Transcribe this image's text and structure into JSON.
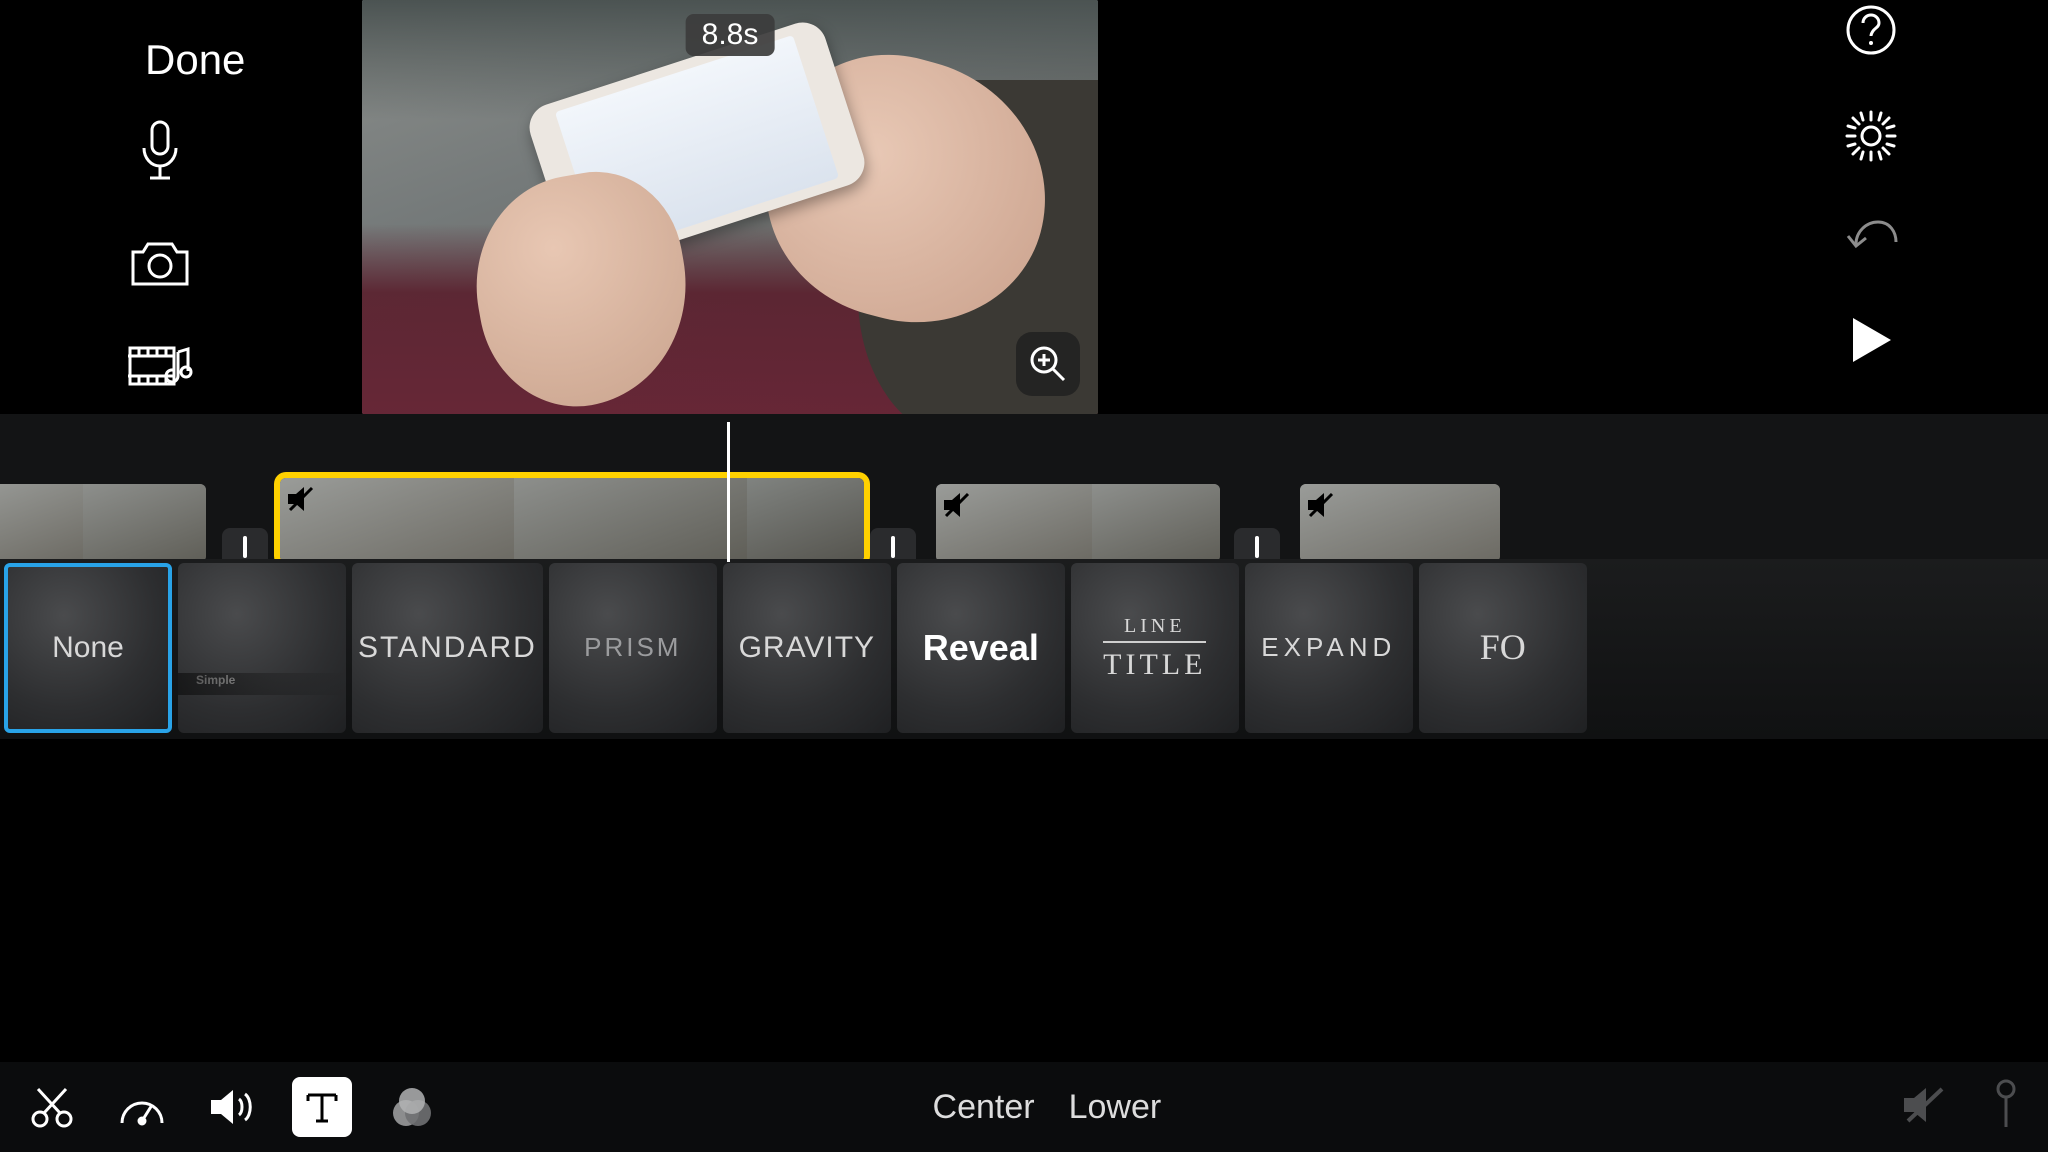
{
  "header": {
    "done_label": "Done",
    "duration_badge": "8.8s"
  },
  "title_styles": [
    {
      "id": "none",
      "label": "None",
      "selected": true
    },
    {
      "id": "simple",
      "label": "Simple"
    },
    {
      "id": "standard",
      "label": "STANDARD"
    },
    {
      "id": "prism",
      "label": "PRISM"
    },
    {
      "id": "gravity",
      "label": "GRAVITY"
    },
    {
      "id": "reveal",
      "label": "Reveal"
    },
    {
      "id": "line",
      "label_top": "LINE",
      "label_bottom": "TITLE"
    },
    {
      "id": "expand",
      "label": "EXPAND"
    },
    {
      "id": "focus",
      "label": "FO"
    }
  ],
  "toolbar": {
    "position_options": {
      "center": "Center",
      "lower": "Lower"
    },
    "active_edit_tool": "text"
  },
  "icons": {
    "mic": "microphone",
    "camera": "camera",
    "media": "media-library",
    "help": "help",
    "gear": "settings",
    "undo": "undo",
    "play": "play",
    "zoom": "zoom-in",
    "scissors": "cut",
    "speed": "speedometer",
    "volume": "volume",
    "text": "text",
    "filter": "color-filter",
    "mute": "muted",
    "pin": "pin"
  }
}
